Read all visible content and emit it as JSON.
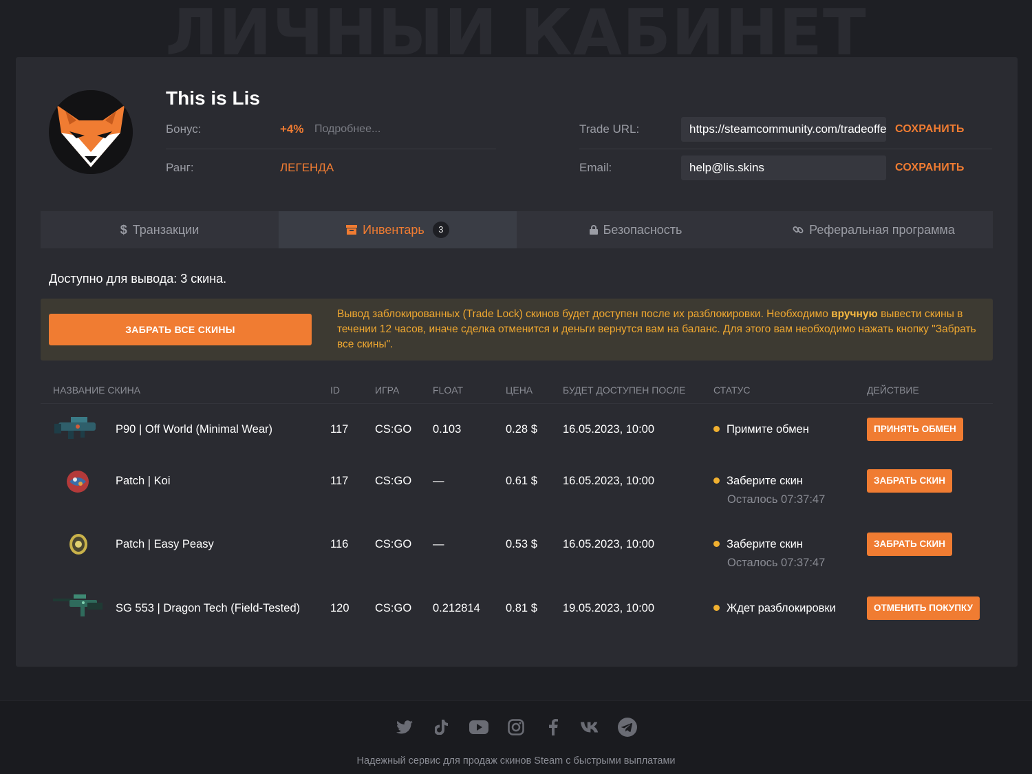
{
  "page": {
    "heading": "ЛИЧНЫЙ КАБИНЕТ"
  },
  "profile": {
    "name": "This is Lis",
    "bonus_label": "Бонус:",
    "bonus_value": "+4%",
    "bonus_more": "Подробнее...",
    "rank_label": "Ранг:",
    "rank_value": "ЛЕГЕНДА",
    "trade_url_label": "Trade URL:",
    "trade_url_value": "https://steamcommunity.com/tradeoffer/new/",
    "email_label": "Email:",
    "email_value": "help@lis.skins",
    "save_label": "СОХРАНИТЬ"
  },
  "tabs": [
    {
      "icon": "dollar-icon",
      "label": "Транзакции"
    },
    {
      "icon": "box-icon",
      "label": "Инвентарь",
      "count": "3"
    },
    {
      "icon": "lock-icon",
      "label": "Безопасность"
    },
    {
      "icon": "link-icon",
      "label": "Реферальная программа"
    }
  ],
  "inventory": {
    "available_text": "Доступно для вывода: 3 скина.",
    "collect_all_label": "ЗАБРАТЬ ВСЕ СКИНЫ",
    "notice_part1": "Вывод заблокированных (Trade Lock) скинов будет доступен после их разблокировки. Необходимо ",
    "notice_bold": "вручную",
    "notice_part2": " вывести скины в течении 12 часов, иначе сделка отменится и деньги вернутся вам на баланс. Для этого вам необходимо нажать кнопку \"Забрать все скины\"."
  },
  "table": {
    "headers": [
      "НАЗВАНИЕ СКИНА",
      "ID",
      "ИГРА",
      "FLOAT",
      "ЦЕНА",
      "БУДЕТ ДОСТУПЕН ПОСЛЕ",
      "СТАТУС",
      "ДЕЙСТВИЕ"
    ],
    "rows": [
      {
        "name": "P90 | Off World (Minimal Wear)",
        "id": "117",
        "game": "CS:GO",
        "float": "0.103",
        "price": "0.28 $",
        "available": "16.05.2023, 10:00",
        "status": "Примите обмен",
        "status_sub": "",
        "action": "ПРИНЯТЬ ОБМЕН",
        "img": "p90-icon"
      },
      {
        "name": "Patch | Koi",
        "id": "117",
        "game": "CS:GO",
        "float": "—",
        "price": "0.61 $",
        "available": "16.05.2023, 10:00",
        "status": "Заберите скин",
        "status_sub": "Осталось 07:37:47",
        "action": "ЗАБРАТЬ СКИН",
        "img": "patch-koi-icon"
      },
      {
        "name": "Patch | Easy Peasy",
        "id": "116",
        "game": "CS:GO",
        "float": "—",
        "price": "0.53 $",
        "available": "16.05.2023, 10:00",
        "status": "Заберите скин",
        "status_sub": "Осталось 07:37:47",
        "action": "ЗАБРАТЬ СКИН",
        "img": "patch-easy-peasy-icon"
      },
      {
        "name": "SG 553 | Dragon Tech (Field-Tested)",
        "id": "120",
        "game": "CS:GO",
        "float": "0.212814",
        "price": "0.81 $",
        "available": "19.05.2023, 10:00",
        "status": "Ждет разблокировки",
        "status_sub": "",
        "action": "ОТМЕНИТЬ ПОКУПКУ",
        "img": "sg553-icon"
      }
    ]
  },
  "footer": {
    "socials": [
      "twitter-icon",
      "tiktok-icon",
      "youtube-icon",
      "instagram-icon",
      "facebook-icon",
      "vk-icon",
      "telegram-icon"
    ],
    "tagline": "Надежный сервис для продаж скинов Steam с быстрыми выплатами"
  },
  "colors": {
    "accent": "#f07c32",
    "notice": "#f0a830",
    "status_dot": "#f0b030"
  }
}
